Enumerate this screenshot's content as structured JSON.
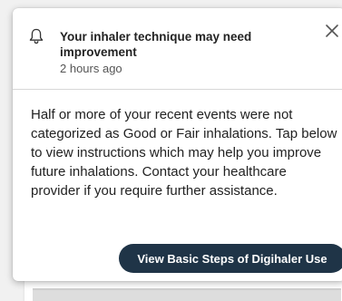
{
  "notification": {
    "title": "Your inhaler technique may need improvement",
    "timestamp": "2 hours ago",
    "message": "Half or more of your recent events were not categorized as Good or Fair inhalations. Tap below to view instructions which may help you improve future inhalations. Contact your healthcare provider if you require further assistance.",
    "action_label": "View Basic Steps of Digihaler Use",
    "icon": "bell-icon",
    "close_icon": "close-icon"
  },
  "colors": {
    "button_bg": "#1f3447",
    "button_text": "#ffffff",
    "title_text": "#232323",
    "body_text": "#222222",
    "divider": "#d7d7d7"
  }
}
